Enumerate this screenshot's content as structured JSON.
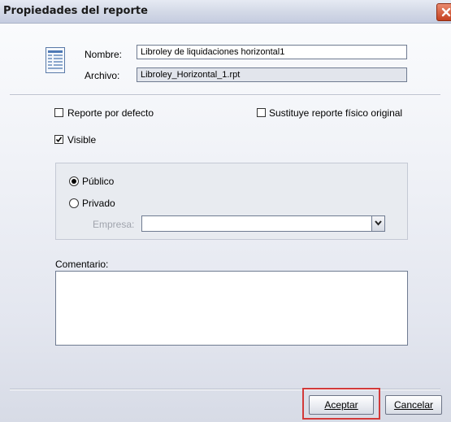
{
  "window": {
    "title": "Propiedades del reporte"
  },
  "icons": {
    "document": "report-document-icon",
    "close": "close-icon",
    "dropdown": "chevron-down-icon"
  },
  "fields": {
    "nombre_label": "Nombre:",
    "nombre_value": "Libroley de liquidaciones horizontal1",
    "archivo_label": "Archivo:",
    "archivo_value": "Libroley_Horizontal_1.rpt"
  },
  "options": {
    "reporte_por_defecto": {
      "label": "Reporte por defecto",
      "checked": false
    },
    "sustituye": {
      "label": "Sustituye reporte físico original",
      "checked": false
    },
    "visible": {
      "label": "Visible",
      "checked": true
    }
  },
  "visibility": {
    "publico": {
      "label": "Público",
      "selected": true
    },
    "privado": {
      "label": "Privado",
      "selected": false
    },
    "empresa_label": "Empresa:",
    "empresa_value": ""
  },
  "comentario": {
    "label": "Comentario:",
    "value": ""
  },
  "buttons": {
    "aceptar": "Aceptar",
    "cancelar": "Cancelar"
  },
  "colors": {
    "highlight": "#d23a3a",
    "close_button": "#c4401f"
  }
}
